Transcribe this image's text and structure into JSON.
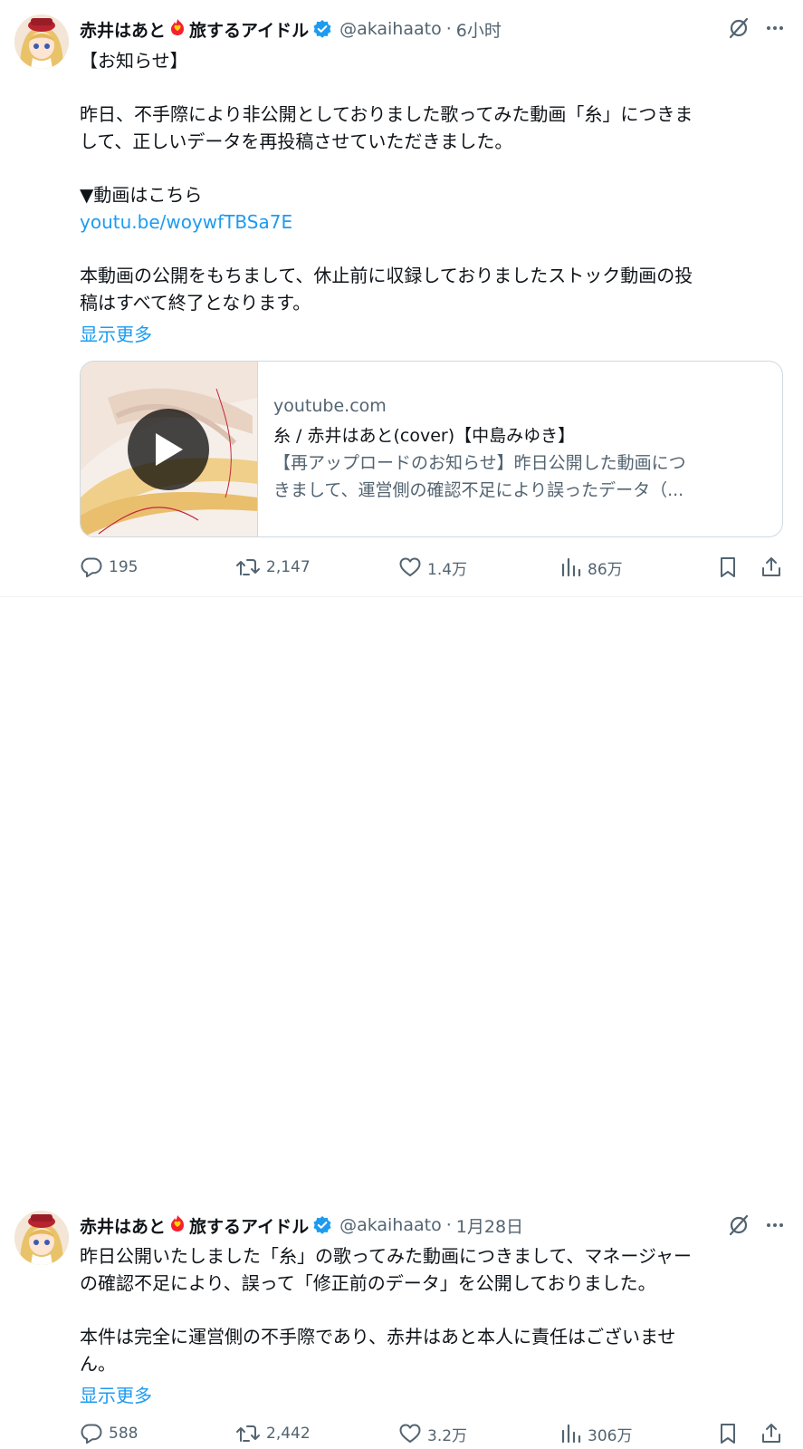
{
  "tweets": [
    {
      "display_name": "赤井はあと",
      "display_name_suffix": "旅するアイドル",
      "handle": "@akaihaato",
      "separator": "·",
      "time": "6小时",
      "lines": [
        "【お知らせ】",
        "",
        "昨日、不手際により非公開としておりました歌ってみた動画「糸」につきま",
        "して、正しいデータを再投稿させていただきました。",
        "",
        "▼動画はこちら"
      ],
      "link": "youtu.be/woywfTBSa7E",
      "lines_after_link": [
        "",
        "本動画の公開をもちまして、休止前に収録しておりましたストック動画の投",
        "稿はすべて終了となります。"
      ],
      "show_more": "显示更多",
      "card": {
        "domain": "youtube.com",
        "title": "糸 / 赤井はあと(cover)【中島みゆき】",
        "desc_line1": "【再アップロードのお知らせ】昨日公開した動画につ",
        "desc_line2": "きまして、運営側の確認不足により誤ったデータ（..."
      },
      "stats": {
        "replies": "195",
        "retweets": "2,147",
        "likes": "1.4万",
        "views": "86万"
      }
    },
    {
      "display_name": "赤井はあと",
      "display_name_suffix": "旅するアイドル",
      "handle": "@akaihaato",
      "separator": "·",
      "time": "1月28日",
      "lines": [
        "昨日公開いたしました「糸」の歌ってみた動画につきまして、マネージャー",
        "の確認不足により、誤って「修正前のデータ」を公開しておりました。",
        "",
        "本件は完全に運営側の不手際であり、赤井はあと本人に責任はございませ",
        "ん。"
      ],
      "show_more": "显示更多",
      "stats": {
        "replies": "588",
        "retweets": "2,442",
        "likes": "3.2万",
        "views": "306万"
      }
    }
  ],
  "colors": {
    "accent": "#1d9bf0",
    "secondary_text": "#536471",
    "border": "#cfd9de",
    "fire": "#f4212e"
  },
  "icons": [
    "grok-icon",
    "more-icon",
    "verified-badge-icon",
    "fire-heart-icon",
    "reply-icon",
    "retweet-icon",
    "like-icon",
    "views-icon",
    "bookmark-icon",
    "share-icon",
    "play-icon"
  ]
}
